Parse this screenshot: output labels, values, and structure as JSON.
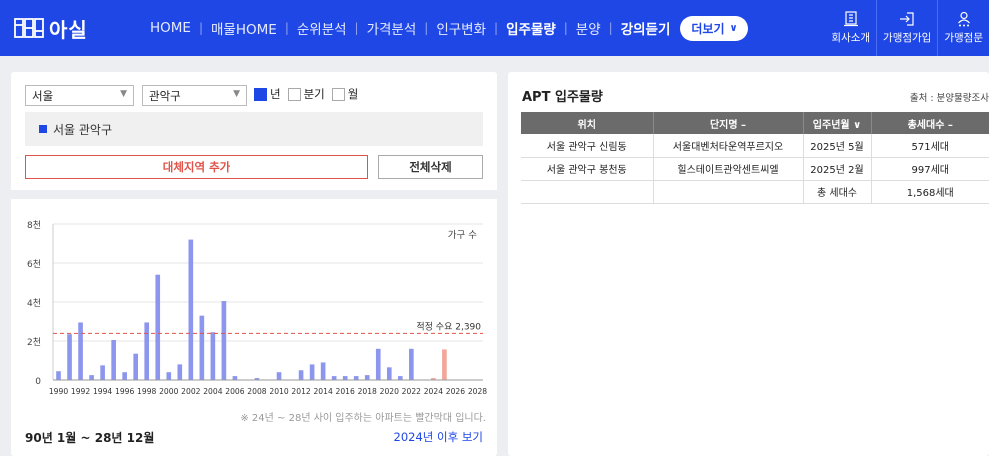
{
  "header": {
    "logo_text": "아실",
    "nav": [
      {
        "label": "HOME",
        "bold": false
      },
      {
        "label": "매물HOME",
        "bold": false
      },
      {
        "label": "순위분석",
        "bold": false
      },
      {
        "label": "가격분석",
        "bold": false
      },
      {
        "label": "인구변화",
        "bold": false
      },
      {
        "label": "입주물량",
        "bold": true
      },
      {
        "label": "분양",
        "bold": false
      },
      {
        "label": "강의듣기",
        "bold": true
      }
    ],
    "more_label": "더보기",
    "right_menu": [
      {
        "label": "회사소개",
        "icon": "building-icon"
      },
      {
        "label": "가맹점가입",
        "icon": "signin-icon"
      },
      {
        "label": "가맹점문",
        "icon": "user-stars-icon"
      }
    ]
  },
  "left_panel": {
    "city_select": "서울",
    "district_select": "관악구",
    "period_options": [
      {
        "label": "년",
        "checked": true
      },
      {
        "label": "분기",
        "checked": false
      },
      {
        "label": "월",
        "checked": false
      }
    ],
    "region_label": "서울 관악구",
    "add_region_label": "대체지역 추가",
    "delete_all_label": "전체삭제",
    "note": "※ 24년 ~ 28년 사이 입주하는 아파트는 빨간막대 입니다.",
    "period_range": "90년 1월 ~ 28년 12월",
    "after_link": "2024년 이후 보기"
  },
  "chart_data": {
    "type": "bar",
    "legend_label": "가구 수",
    "threshold_label": "적정 수요 2,390",
    "threshold_value": 2390,
    "ylim": [
      0,
      8000
    ],
    "yticks": [
      0,
      2000,
      4000,
      6000,
      8000
    ],
    "ytick_labels": [
      "0",
      "2천",
      "4천",
      "6천",
      "8천"
    ],
    "xtick_labels": [
      "1990",
      "1992",
      "1994",
      "1996",
      "1998",
      "2000",
      "2002",
      "2004",
      "2006",
      "2008",
      "2010",
      "2012",
      "2014",
      "2016",
      "2018",
      "2020",
      "2022",
      "2024",
      "2026",
      "2028"
    ],
    "x": [
      1990,
      1991,
      1992,
      1993,
      1994,
      1995,
      1996,
      1997,
      1998,
      1999,
      2000,
      2001,
      2002,
      2003,
      2004,
      2005,
      2006,
      2007,
      2008,
      2009,
      2010,
      2011,
      2012,
      2013,
      2014,
      2015,
      2016,
      2017,
      2018,
      2019,
      2020,
      2021,
      2022,
      2023,
      2024,
      2025,
      2026,
      2027,
      2028
    ],
    "values": [
      450,
      2350,
      2950,
      250,
      750,
      2050,
      400,
      1350,
      2950,
      5400,
      400,
      800,
      7200,
      3300,
      2450,
      4050,
      200,
      0,
      100,
      0,
      400,
      0,
      500,
      800,
      900,
      200,
      200,
      200,
      250,
      1600,
      650,
      200,
      1600,
      0,
      100,
      1568,
      0,
      0,
      0
    ],
    "highlight_from": 2024,
    "bar_color": "#8c96ee",
    "highlight_color": "#f3a79a",
    "threshold_color": "#e0534a"
  },
  "right_panel": {
    "title": "APT 입주물량",
    "source": "출처 : 분양물량조사",
    "columns": [
      "위치",
      "단지명 –",
      "입주년월 ∨",
      "총세대수 –"
    ],
    "rows": [
      [
        "서울 관악구 신림동",
        "서울대벤처타운역푸르지오",
        "2025년 5월",
        "571세대"
      ],
      [
        "서울 관악구 봉천동",
        "힐스테이트관악센트씨엘",
        "2025년 2월",
        "997세대"
      ]
    ],
    "total_label": "총 세대수",
    "total_value": "1,568세대"
  }
}
